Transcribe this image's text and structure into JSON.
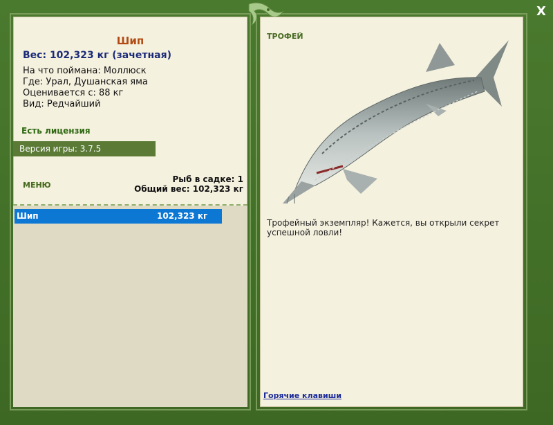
{
  "fish": {
    "name": "Шип",
    "weight": "Вес: 102,323 кг (зачетная)",
    "bait": "На что поймана: Моллюск",
    "location": "Где: Урал, Душанская яма",
    "valued_from": "Оценивается с: 88 кг",
    "kind": "Вид: Редчайший"
  },
  "license": "Есть лицензия",
  "version": "Версия игры: 3.7.5",
  "menu_label": "МЕНЮ",
  "stats": {
    "count": "Рыб в садке: 1",
    "total": "Общий вес: 102,323 кг"
  },
  "catch_list": [
    {
      "name": "Шип",
      "weight": "102,323 кг"
    }
  ],
  "trophy": {
    "label": "ТРОФЕЙ",
    "text": "Трофейный экземпляр! Кажется, вы открыли секрет успешной ловли!"
  },
  "hotkeys": "Горячие клавиши",
  "close_label": "X",
  "colors": {
    "frame": "#3f6b27",
    "panel": "#f5f1df",
    "selected_row": "#0d77d4",
    "fish_name": "#b34a12",
    "weight": "#1a2a78"
  }
}
